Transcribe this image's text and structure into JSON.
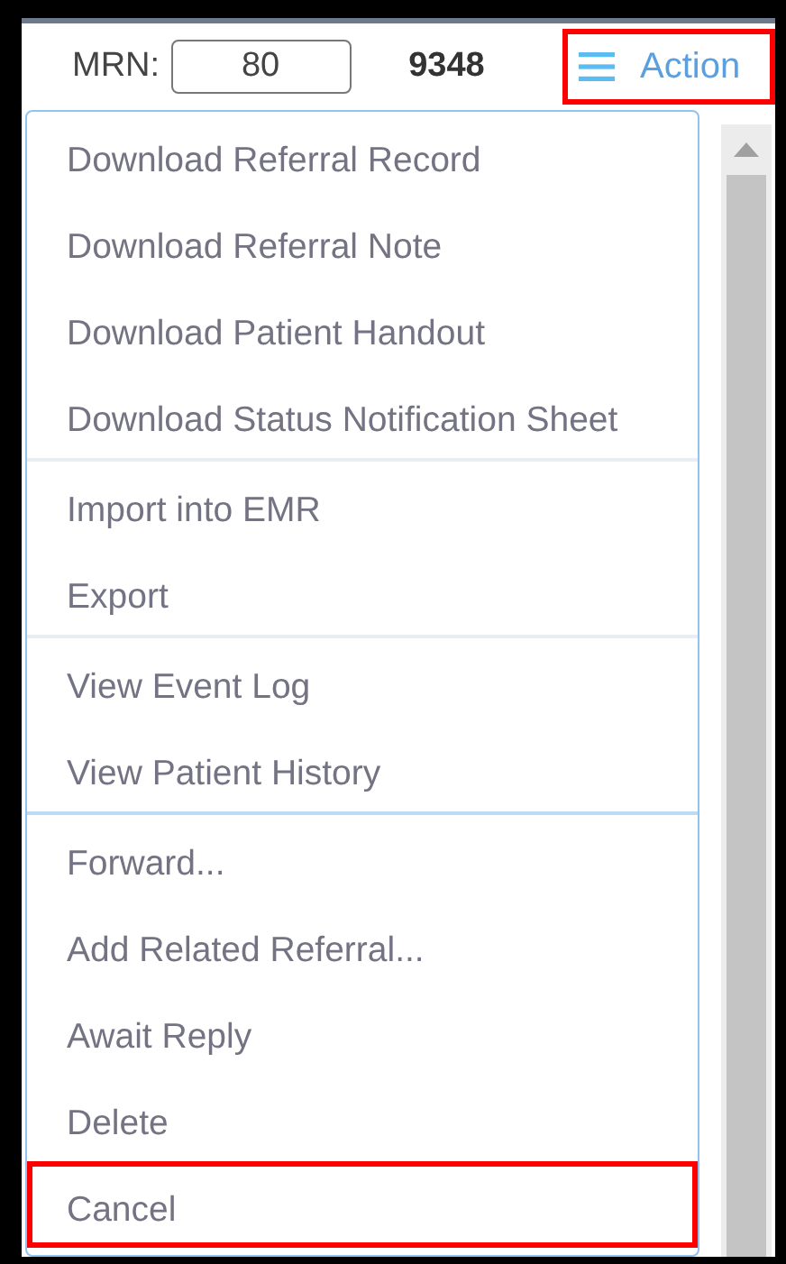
{
  "header": {
    "mrn_label": "MRN:",
    "mrn_field": {
      "value": "80"
    },
    "number": "9348",
    "action_button": {
      "label": "Action",
      "highlighted": true
    }
  },
  "menu": {
    "groups": [
      {
        "items": [
          {
            "label": "Download Referral Record",
            "highlighted": false
          },
          {
            "label": "Download Referral Note",
            "highlighted": false
          },
          {
            "label": "Download Patient Handout",
            "highlighted": false
          },
          {
            "label": "Download Status Notification Sheet",
            "highlighted": false
          }
        ]
      },
      {
        "items": [
          {
            "label": "Import into EMR",
            "highlighted": false
          },
          {
            "label": "Export",
            "highlighted": false
          }
        ]
      },
      {
        "items": [
          {
            "label": "View Event Log",
            "highlighted": false
          },
          {
            "label": "View Patient History",
            "highlighted": false
          }
        ]
      },
      {
        "items": [
          {
            "label": "Forward...",
            "highlighted": false
          },
          {
            "label": "Add Related Referral...",
            "highlighted": false
          },
          {
            "label": "Await Reply",
            "highlighted": false
          },
          {
            "label": "Delete",
            "highlighted": false
          },
          {
            "label": "Cancel",
            "highlighted": true
          }
        ]
      }
    ]
  }
}
